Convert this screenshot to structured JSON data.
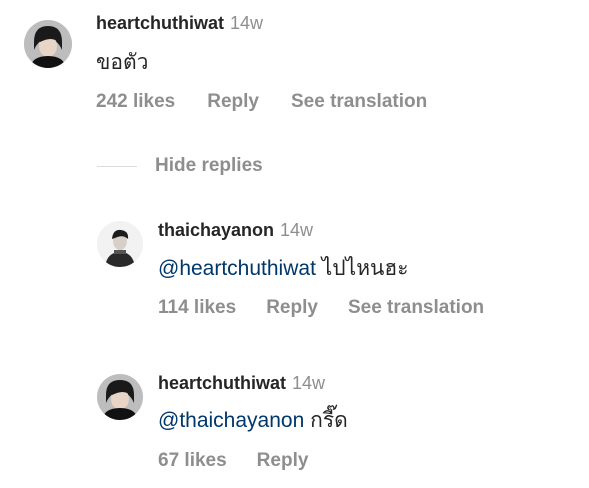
{
  "comments": {
    "main": {
      "username": "heartchuthiwat",
      "time": "14w",
      "text": "ขอตัว",
      "likes": "242 likes",
      "reply": "Reply",
      "translate": "See translation"
    },
    "hide_replies": "Hide replies",
    "reply1": {
      "username": "thaichayanon",
      "time": "14w",
      "mention": "@heartchuthiwat",
      "text": "ไปไหนฮะ",
      "likes": "114 likes",
      "reply": "Reply",
      "translate": "See translation"
    },
    "reply2": {
      "username": "heartchuthiwat",
      "time": "14w",
      "mention": "@thaichayanon",
      "text": "กรี๊ด",
      "likes": "67 likes",
      "reply": "Reply"
    }
  },
  "colors": {
    "text": "#262626",
    "secondary": "#8e8e8e",
    "mention": "#00376b",
    "divider": "#dbdbdb"
  }
}
